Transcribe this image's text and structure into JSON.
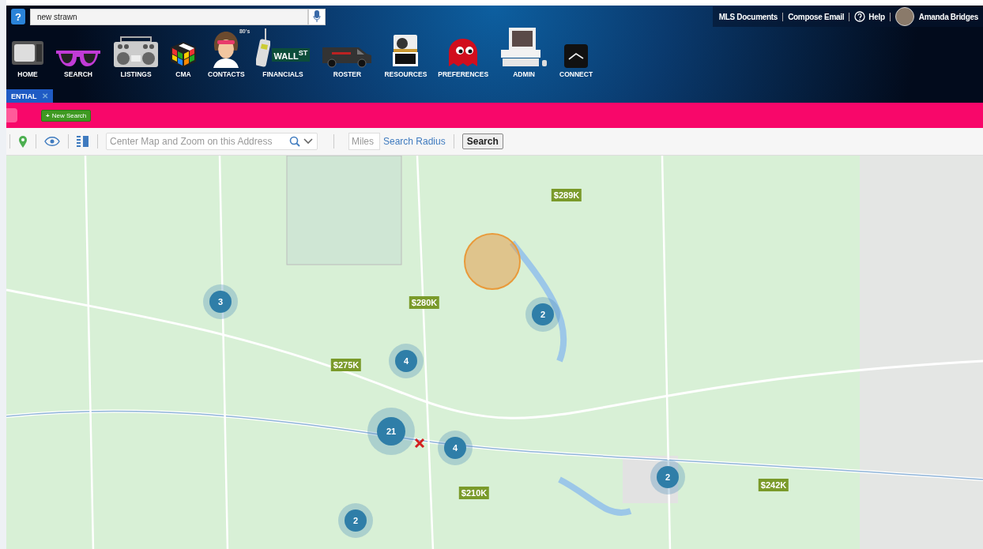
{
  "header": {
    "search": {
      "value": "new strawn"
    },
    "help_badge": "?",
    "nav": [
      "HOME",
      "SEARCH",
      "LISTINGS",
      "CMA",
      "CONTACTS",
      "FINANCIALS",
      "ROSTER",
      "RESOURCES",
      "PREFERENCES",
      "ADMIN",
      "CONNECT"
    ],
    "wall_sign": "WALL",
    "wall_sup": "ST",
    "contacts_badge": "80's",
    "links": [
      "MLS Documents",
      "Compose Email",
      "Help"
    ],
    "user": "Amanda Bridges",
    "tab": {
      "label": "ENTIAL",
      "close": "✕"
    }
  },
  "action_bar": {
    "new_search_plus": "+",
    "new_search": "New Search"
  },
  "toolbar": {
    "address": {
      "placeholder": "Center Map and Zoom on this Address"
    },
    "miles": {
      "placeholder": "Miles"
    },
    "radius_link": "Search Radius",
    "search_button": "Search"
  },
  "map": {
    "clusters": [
      "3",
      "2",
      "4",
      "21",
      "4",
      "2",
      "2"
    ],
    "prices": [
      "$289K",
      "$280K",
      "$275K",
      "$210K",
      "$242K"
    ]
  }
}
